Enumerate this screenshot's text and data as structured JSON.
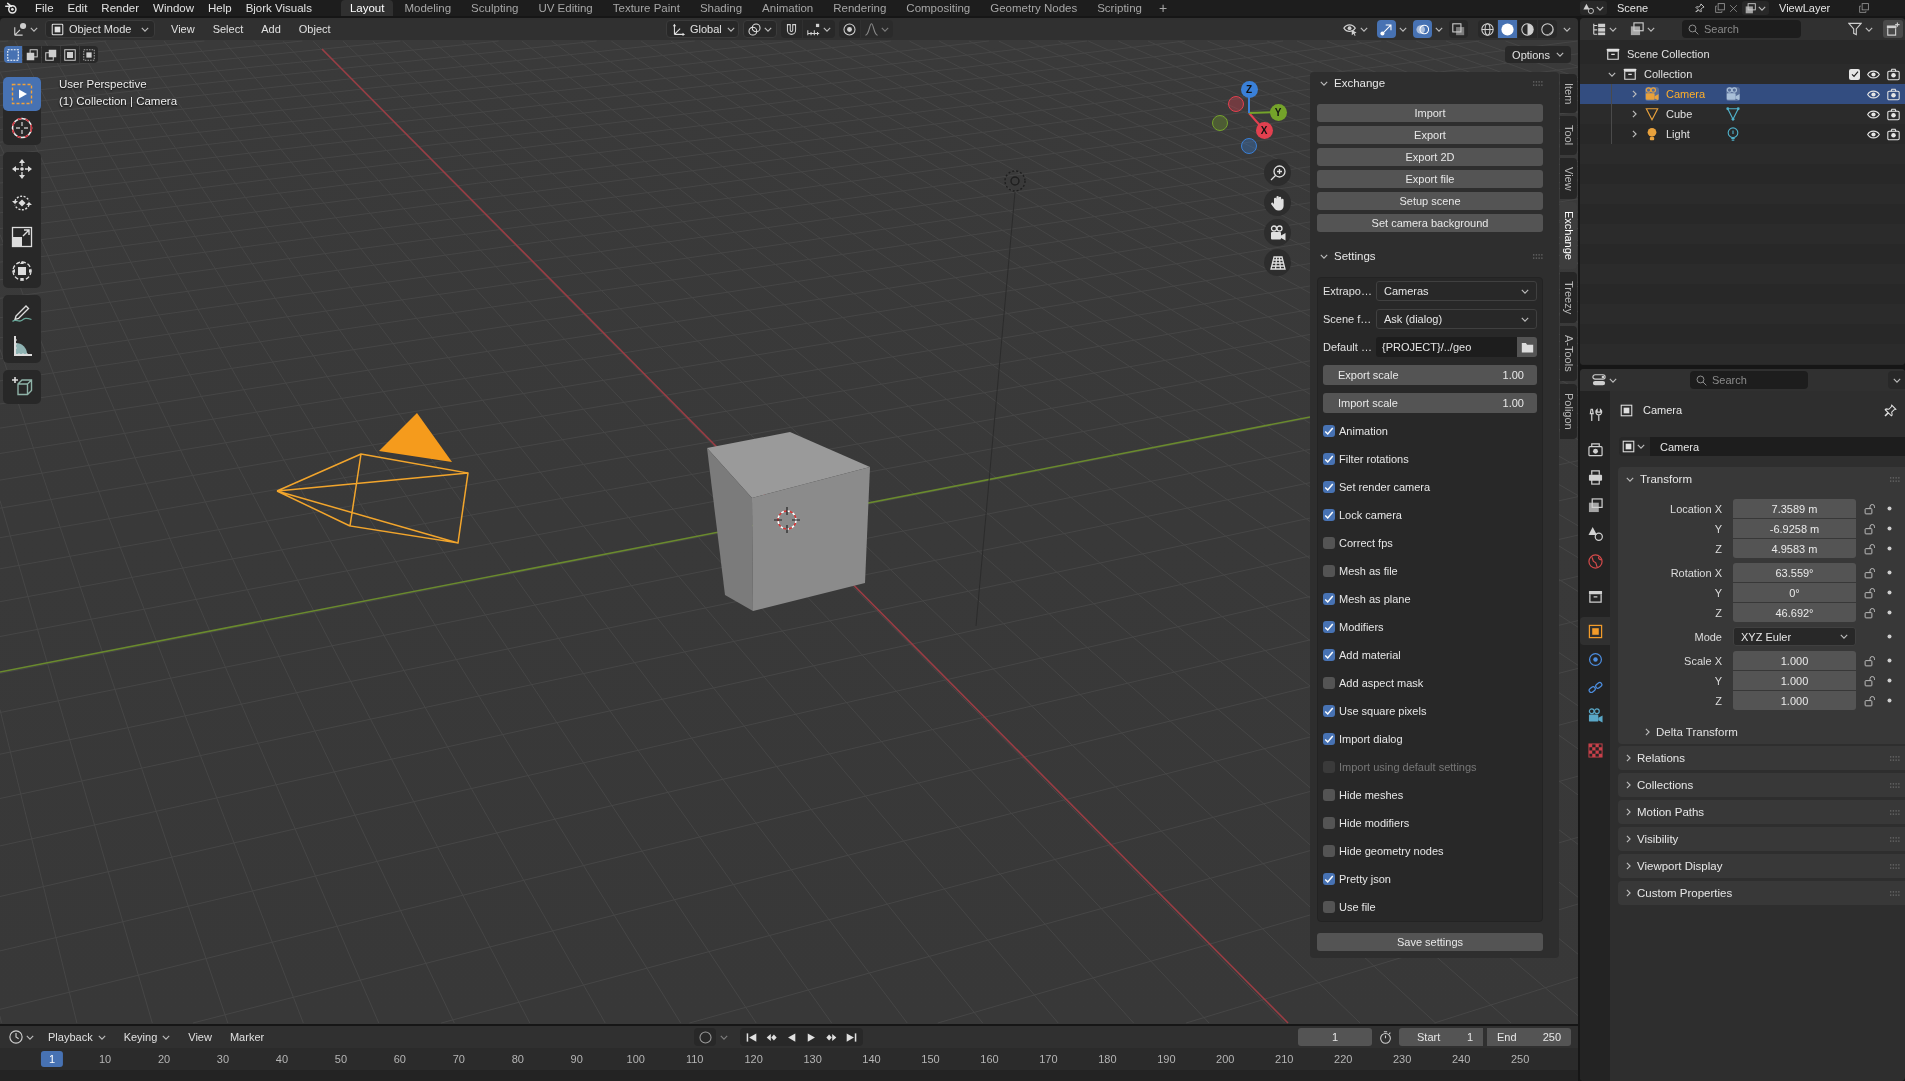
{
  "topbar": {
    "menus": [
      "File",
      "Edit",
      "Render",
      "Window",
      "Help",
      "Bjork Visuals"
    ],
    "workspaces": [
      {
        "label": "Layout",
        "selected": true
      },
      {
        "label": "Modeling",
        "selected": false
      },
      {
        "label": "Sculpting",
        "selected": false
      },
      {
        "label": "UV Editing",
        "selected": false
      },
      {
        "label": "Texture Paint",
        "selected": false
      },
      {
        "label": "Shading",
        "selected": false
      },
      {
        "label": "Animation",
        "selected": false
      },
      {
        "label": "Rendering",
        "selected": false
      },
      {
        "label": "Compositing",
        "selected": false
      },
      {
        "label": "Geometry Nodes",
        "selected": false
      },
      {
        "label": "Scripting",
        "selected": false
      }
    ],
    "add_workspace": "+",
    "scene": "Scene",
    "view_layer": "ViewLayer"
  },
  "viewport": {
    "mode": "Object Mode",
    "menus": [
      "View",
      "Select",
      "Add",
      "Object"
    ],
    "orientation": "Global",
    "toggles": [
      {
        "kind": "gizmos",
        "on": true
      },
      {
        "kind": "overlays",
        "on": true
      },
      {
        "kind": "xray",
        "on": false
      }
    ],
    "shading": [
      {
        "kind": "wireframe",
        "selected": false
      },
      {
        "kind": "solid",
        "selected": true
      },
      {
        "kind": "material",
        "selected": false
      },
      {
        "kind": "rendered",
        "selected": false
      }
    ],
    "select_modes": [
      {
        "kind": "set",
        "selected": true
      },
      {
        "kind": "extend",
        "selected": false
      },
      {
        "kind": "subtract",
        "selected": false
      },
      {
        "kind": "difference",
        "selected": false
      },
      {
        "kind": "intersect",
        "selected": false
      }
    ],
    "options": "Options",
    "tools": [
      [
        {
          "kind": "select_box",
          "selected": true
        },
        {
          "kind": "cursor",
          "selected": false
        }
      ],
      [
        {
          "kind": "move",
          "selected": false
        },
        {
          "kind": "rotate",
          "selected": false
        },
        {
          "kind": "scale",
          "selected": false
        },
        {
          "kind": "transform",
          "selected": false
        }
      ],
      [
        {
          "kind": "annotate",
          "selected": false
        },
        {
          "kind": "measure",
          "selected": false
        }
      ],
      [
        {
          "kind": "add_cube",
          "selected": false
        }
      ]
    ],
    "info": [
      "User Perspective",
      "(1) Collection | Camera"
    ],
    "gizmo_axes": [
      {
        "label": "X",
        "color": "#e2404f"
      },
      {
        "label": "Y",
        "color": "#74a32a"
      },
      {
        "label": "Z",
        "color": "#3a80d8"
      }
    ]
  },
  "sidebar": {
    "tabs": [
      {
        "label": "Item",
        "selected": false
      },
      {
        "label": "Tool",
        "selected": false
      },
      {
        "label": "View",
        "selected": false
      },
      {
        "label": "Exchange",
        "selected": true
      },
      {
        "label": "Treezy",
        "selected": false
      },
      {
        "label": "A-Tools",
        "selected": false
      },
      {
        "label": "Poligon",
        "selected": false
      }
    ],
    "exchange": {
      "title": "Exchange",
      "expanded": true,
      "buttons": [
        "Import",
        "Export",
        "Export 2D",
        "Export file",
        "Setup scene",
        "Set camera background"
      ]
    },
    "settings": {
      "title": "Settings",
      "expanded": true,
      "fields": [
        {
          "kind": "dropdown",
          "label": "Extrapo…",
          "value": "Cameras"
        },
        {
          "kind": "dropdown",
          "label": "Scene f…",
          "value": "Ask (dialog)"
        },
        {
          "kind": "path",
          "label": "Default …",
          "value": "{PROJECT}/../geo"
        },
        {
          "kind": "number",
          "label": "Export scale",
          "value": "1.00"
        },
        {
          "kind": "number",
          "label": "Import scale",
          "value": "1.00"
        }
      ],
      "checkboxes": [
        {
          "label": "Animation",
          "checked": true,
          "disabled": false
        },
        {
          "label": "Filter rotations",
          "checked": true,
          "disabled": false
        },
        {
          "label": "Set render camera",
          "checked": true,
          "disabled": false
        },
        {
          "label": "Lock camera",
          "checked": true,
          "disabled": false
        },
        {
          "label": "Correct fps",
          "checked": false,
          "disabled": false
        },
        {
          "label": "Mesh as file",
          "checked": false,
          "disabled": false
        },
        {
          "label": "Mesh as plane",
          "checked": true,
          "disabled": false
        },
        {
          "label": "Modifiers",
          "checked": true,
          "disabled": false
        },
        {
          "label": "Add material",
          "checked": true,
          "disabled": false
        },
        {
          "label": "Add aspect mask",
          "checked": false,
          "disabled": false
        },
        {
          "label": "Use square pixels",
          "checked": true,
          "disabled": false
        },
        {
          "label": "Import dialog",
          "checked": true,
          "disabled": false
        },
        {
          "label": "Import using default settings",
          "checked": false,
          "disabled": true
        },
        {
          "label": "Hide meshes",
          "checked": false,
          "disabled": false
        },
        {
          "label": "Hide modifiers",
          "checked": false,
          "disabled": false
        },
        {
          "label": "Hide geometry nodes",
          "checked": false,
          "disabled": false
        },
        {
          "label": "Pretty json",
          "checked": true,
          "disabled": false
        },
        {
          "label": "Use file",
          "checked": false,
          "disabled": false
        }
      ],
      "save": "Save settings"
    }
  },
  "outliner": {
    "search": {
      "placeholder": "Search"
    },
    "tree": [
      {
        "label": "Scene Collection",
        "kind": "scene_collection",
        "selected": false,
        "children": [
          {
            "label": "Collection",
            "kind": "collection",
            "selected": false,
            "expanded": true,
            "checked": true,
            "children": [
              {
                "label": "Camera",
                "kind": "camera",
                "selected": true,
                "expanded": false
              },
              {
                "label": "Cube",
                "kind": "mesh",
                "selected": false,
                "expanded": false
              },
              {
                "label": "Light",
                "kind": "light",
                "selected": false,
                "expanded": false
              }
            ]
          }
        ]
      }
    ]
  },
  "properties": {
    "search": {
      "placeholder": "Search"
    },
    "tabs": [
      [
        {
          "kind": "tool",
          "selected": false
        }
      ],
      [
        {
          "kind": "render",
          "selected": false
        },
        {
          "kind": "output",
          "selected": false
        },
        {
          "kind": "view_layer",
          "selected": false
        },
        {
          "kind": "scene",
          "selected": false
        },
        {
          "kind": "world",
          "selected": false
        }
      ],
      [
        {
          "kind": "collection",
          "selected": false
        }
      ],
      [
        {
          "kind": "object",
          "selected": true
        },
        {
          "kind": "physics",
          "selected": false
        },
        {
          "kind": "constraints",
          "selected": false
        },
        {
          "kind": "data",
          "selected": false
        }
      ],
      [
        {
          "kind": "texture",
          "selected": false
        }
      ]
    ],
    "context": "Camera",
    "object_name": "Camera",
    "transform": {
      "title": "Transform",
      "expanded": true,
      "groups": [
        {
          "kind": "vector",
          "rows": [
            {
              "label": "Location X",
              "value": "7.3589 m"
            },
            {
              "label": "Y",
              "value": "-6.9258 m"
            },
            {
              "label": "Z",
              "value": "4.9583 m"
            }
          ]
        },
        {
          "kind": "vector",
          "rows": [
            {
              "label": "Rotation X",
              "value": "63.559°"
            },
            {
              "label": "Y",
              "value": "0°"
            },
            {
              "label": "Z",
              "value": "46.692°"
            }
          ]
        },
        {
          "kind": "dropdown",
          "rows": [
            {
              "label": "Mode",
              "value": "XYZ Euler"
            }
          ]
        },
        {
          "kind": "vector",
          "rows": [
            {
              "label": "Scale X",
              "value": "1.000"
            },
            {
              "label": "Y",
              "value": "1.000"
            },
            {
              "label": "Z",
              "value": "1.000"
            }
          ]
        }
      ],
      "subpanel": {
        "title": "Delta Transform",
        "expanded": false
      }
    },
    "panels": [
      {
        "title": "Relations",
        "expanded": false
      },
      {
        "title": "Collections",
        "expanded": false
      },
      {
        "title": "Motion Paths",
        "expanded": false
      },
      {
        "title": "Visibility",
        "expanded": false
      },
      {
        "title": "Viewport Display",
        "expanded": false
      },
      {
        "title": "Custom Properties",
        "expanded": false
      }
    ]
  },
  "timeline": {
    "menus": [
      {
        "label": "Playback",
        "dropdown": true
      },
      {
        "label": "Keying",
        "dropdown": true
      },
      {
        "label": "View",
        "dropdown": false
      },
      {
        "label": "Marker",
        "dropdown": false
      }
    ],
    "auto_keying": false,
    "current_frame": "1",
    "start": {
      "label": "Start",
      "value": "1"
    },
    "end": {
      "label": "End",
      "value": "250"
    },
    "ruler": [
      {
        "label": "1",
        "selected": true
      },
      {
        "label": "10",
        "selected": false
      },
      {
        "label": "20",
        "selected": false
      },
      {
        "label": "30",
        "selected": false
      },
      {
        "label": "40",
        "selected": false
      },
      {
        "label": "50",
        "selected": false
      },
      {
        "label": "60",
        "selected": false
      },
      {
        "label": "70",
        "selected": false
      },
      {
        "label": "80",
        "selected": false
      },
      {
        "label": "90",
        "selected": false
      },
      {
        "label": "100",
        "selected": false
      },
      {
        "label": "110",
        "selected": false
      },
      {
        "label": "120",
        "selected": false
      },
      {
        "label": "130",
        "selected": false
      },
      {
        "label": "140",
        "selected": false
      },
      {
        "label": "150",
        "selected": false
      },
      {
        "label": "160",
        "selected": false
      },
      {
        "label": "170",
        "selected": false
      },
      {
        "label": "180",
        "selected": false
      },
      {
        "label": "190",
        "selected": false
      },
      {
        "label": "200",
        "selected": false
      },
      {
        "label": "210",
        "selected": false
      },
      {
        "label": "220",
        "selected": false
      },
      {
        "label": "230",
        "selected": false
      },
      {
        "label": "240",
        "selected": false
      },
      {
        "label": "250",
        "selected": false
      }
    ]
  }
}
